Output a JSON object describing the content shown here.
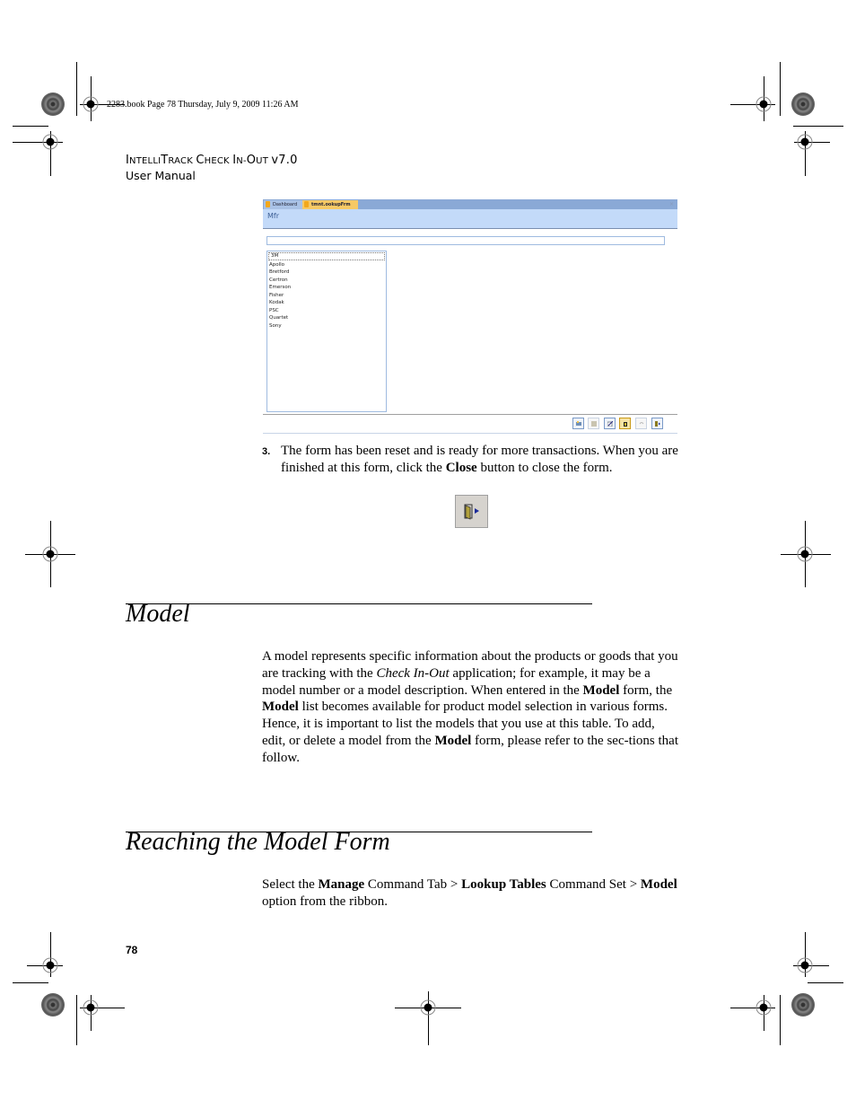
{
  "slug": "2283.book  Page 78  Thursday, July 9, 2009  11:26 AM",
  "running_header": {
    "product_parts": [
      {
        "big": "I",
        "small": "NTELLI"
      },
      {
        "big": "T",
        "small": "RACK "
      },
      {
        "big": "C",
        "small": "HECK "
      },
      {
        "big": "I",
        "small": "N-"
      },
      {
        "big": "O",
        "small": "UT "
      }
    ],
    "product_suffix": "v7.0",
    "subtitle": "User Manual"
  },
  "screenshot": {
    "tabs": [
      {
        "label": "Dashboard",
        "active": false
      },
      {
        "label": "tmnt.ookupFrm",
        "active": true
      }
    ],
    "close_glyph": "×",
    "form_title": "Mfr",
    "search_value": "",
    "list_items": [
      "3M",
      "Apollo",
      "Bretford",
      "Certron",
      "Emerson",
      "Fisher",
      "Kodak",
      "PSC",
      "Quartet",
      "Sony"
    ],
    "selected_index": 0,
    "toolbar_buttons": [
      {
        "name": "new",
        "enabled": true
      },
      {
        "name": "save",
        "enabled": false
      },
      {
        "name": "edit",
        "enabled": true
      },
      {
        "name": "delete",
        "enabled": true
      },
      {
        "name": "undo",
        "enabled": false
      },
      {
        "name": "close",
        "enabled": true
      }
    ]
  },
  "step3": {
    "number": "3.",
    "text_before": "The form has been reset and is ready for more transactions. When you are finished at this form, click the ",
    "bold": "Close",
    "text_after": " button to close the form."
  },
  "section_model": {
    "heading": "Model",
    "p_1": "A model represents specific information about the products or goods that you are tracking with the ",
    "p_italic": "Check In-Out",
    "p_2": " application; for example, it may be a model number or a model description. When entered in the ",
    "p_bold1": "Model",
    "p_3": " form, the ",
    "p_bold2": "Model",
    "p_4": " list becomes available for product model selection in various forms. Hence, it is important to list the models that you use at this table. To add, edit, or delete a model from the ",
    "p_bold3": "Model",
    "p_5": " form, please refer to the sec-tions that follow."
  },
  "section_reaching": {
    "heading": "Reaching the Model Form",
    "t1": "Select the ",
    "b1": "Manage",
    "t2": " Command Tab > ",
    "b2": "Lookup Tables",
    "t3": " Command Set > ",
    "b3": "Model",
    "t4": " option from the ribbon."
  },
  "page_number": "78"
}
